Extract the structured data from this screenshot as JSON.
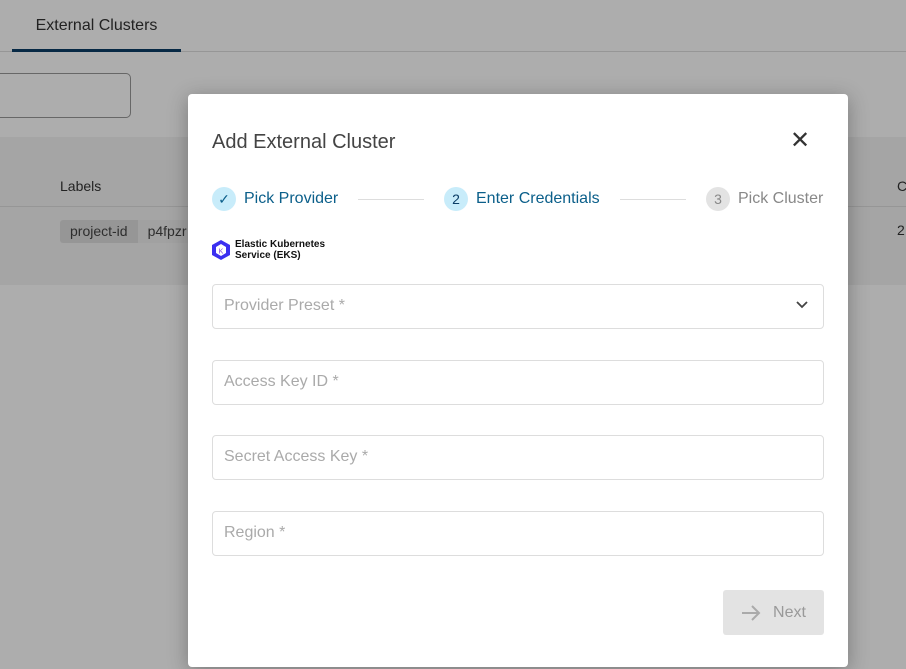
{
  "background": {
    "tab": "External Clusters",
    "labels_header": "Labels",
    "partial_header": "C",
    "chip_key": "project-id",
    "chip_value": "p4fpzr",
    "partial_cell": "2"
  },
  "modal": {
    "title": "Add External Cluster",
    "close_icon": "close-icon",
    "steps": [
      {
        "label": "Pick Provider",
        "state": "done",
        "marker": "✓"
      },
      {
        "label": "Enter Credentials",
        "state": "active",
        "marker": "2"
      },
      {
        "label": "Pick Cluster",
        "state": "pending",
        "marker": "3"
      }
    ],
    "provider": {
      "name_line1": "Elastic Kubernetes",
      "name_line2": "Service (EKS)"
    },
    "fields": {
      "preset": "Provider Preset *",
      "access_key": "Access Key ID *",
      "secret": "Secret Access Key *",
      "region": "Region *"
    },
    "next_label": "Next",
    "colors": {
      "accent": "#0b5f8a",
      "step_bg": "#c8ecfa",
      "disabled": "#e3e3e3"
    }
  }
}
